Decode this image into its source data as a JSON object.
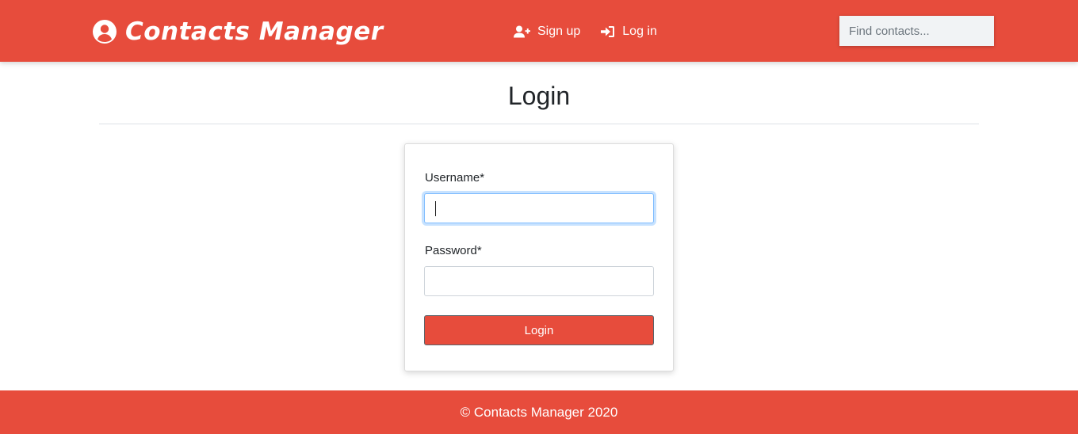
{
  "colors": {
    "brand": "#e74c3c",
    "focus_ring": "#80bdff"
  },
  "navbar": {
    "brand_icon": "user-circle-icon",
    "brand_text": "Contacts Manager",
    "links": [
      {
        "label": "Sign up",
        "icon": "user-plus-icon"
      },
      {
        "label": "Log in",
        "icon": "sign-in-icon"
      }
    ],
    "search": {
      "placeholder": "Find contacts...",
      "value": ""
    }
  },
  "main": {
    "title": "Login",
    "form": {
      "username_label": "Username*",
      "username_value": "",
      "password_label": "Password*",
      "password_value": "",
      "submit_label": "Login"
    }
  },
  "footer": {
    "text": "© Contacts Manager 2020"
  }
}
